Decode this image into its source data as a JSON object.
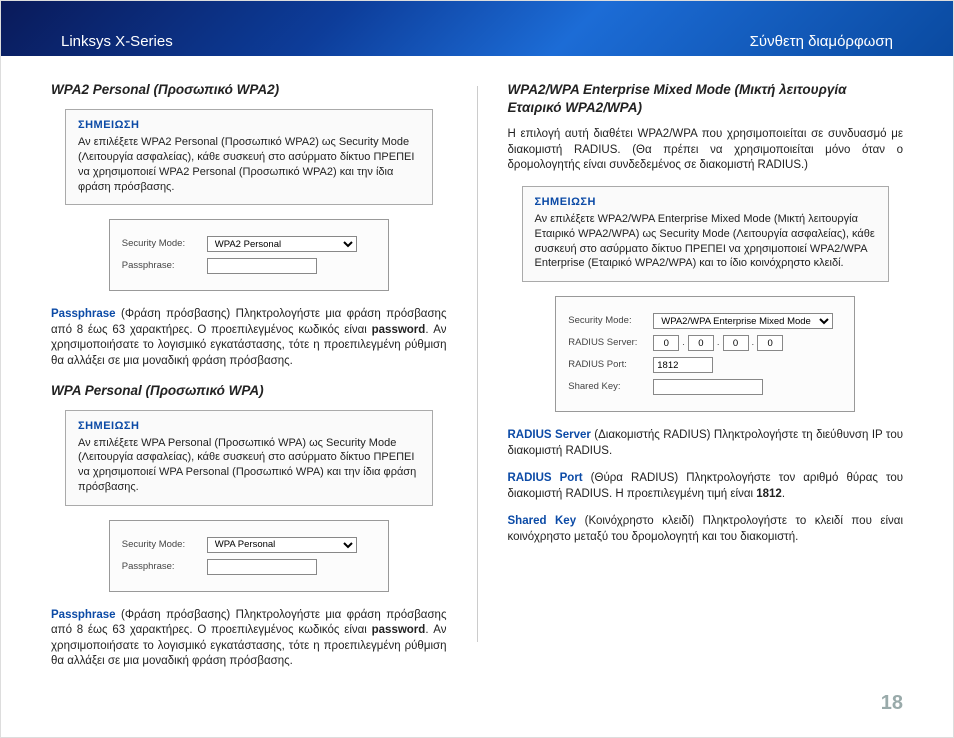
{
  "header": {
    "left": "Linksys X-Series",
    "right": "Σύνθετη διαμόρφωση"
  },
  "pageNumber": "18",
  "left": {
    "s1": {
      "heading": "WPA2 Personal (Προσωπικό WPA2)",
      "noteTitle": "ΣΗΜΕΙΩΣΗ",
      "note": "Αν επιλέξετε WPA2 Personal (Προσωπικό WPA2) ως Security Mode (Λειτουργία ασφαλείας), κάθε συσκευή στο ασύρματο δίκτυο ΠΡΕΠΕΙ να χρησιμοποιεί WPA2 Personal (Προσωπικό WPA2) και την ίδια φράση πρόσβασης.",
      "panel": {
        "secModeLabel": "Security Mode:",
        "secModeValue": "WPA2 Personal",
        "passLabel": "Passphrase:",
        "passValue": ""
      },
      "term": "Passphrase",
      "text1": " (Φράση πρόσβασης) Πληκτρολογήστε μια φράση πρόσβασης από 8 έως 63 χαρακτήρες. Ο προεπιλεγμένος κωδικός είναι ",
      "bold": "password",
      "text2": ". Αν χρησιμοποιήσατε το λογισμικό εγκατάστασης, τότε η προεπιλεγμένη ρύθμιση θα αλλάξει σε μια μοναδική φράση πρόσβασης."
    },
    "s2": {
      "heading": "WPA Personal (Προσωπικό WPA)",
      "noteTitle": "ΣΗΜΕΙΩΣΗ",
      "note": "Αν επιλέξετε WPA Personal (Προσωπικό WPA) ως Security Mode (Λειτουργία ασφαλείας), κάθε συσκευή στο ασύρματο δίκτυο ΠΡΕΠΕΙ να χρησιμοποιεί WPA Personal (Προσωπικό WPA) και την ίδια φράση πρόσβασης.",
      "panel": {
        "secModeLabel": "Security Mode:",
        "secModeValue": "WPA Personal",
        "passLabel": "Passphrase:",
        "passValue": ""
      },
      "term": "Passphrase",
      "text1": " (Φράση πρόσβασης) Πληκτρολογήστε μια φράση πρόσβασης από 8 έως 63 χαρακτήρες. Ο προεπιλεγμένος κωδικός είναι ",
      "bold": "password",
      "text2": ". Αν χρησιμοποιήσατε το λογισμικό εγκατάστασης, τότε η προεπιλεγμένη ρύθμιση θα αλλάξει σε μια μοναδική φράση πρόσβασης."
    }
  },
  "right": {
    "heading": "WPA2/WPA Enterprise Mixed Mode (Μικτή λειτουργία Εταιρικό WPA2/WPA)",
    "intro": "Η επιλογή αυτή διαθέτει WPA2/WPA που χρησιμοποιείται σε συνδυασμό με διακομιστή RADIUS. (Θα πρέπει να χρησιμοποιείται μόνο όταν ο δρομολογητής είναι συνδεδεμένος σε διακομιστή RADIUS.)",
    "noteTitle": "ΣΗΜΕΙΩΣΗ",
    "note": "Αν επιλέξετε WPA2/WPA Enterprise Mixed Mode (Μικτή λειτουργία Εταιρικό WPA2/WPA) ως Security Mode (Λειτουργία ασφαλείας), κάθε συσκευή στο ασύρματο δίκτυο ΠΡΕΠΕΙ να χρησιμοποιεί WPA2/WPA Enterprise (Εταιρικό WPA2/WPA) και το ίδιο κοινόχρηστο κλειδί.",
    "panel": {
      "secModeLabel": "Security Mode:",
      "secModeValue": "WPA2/WPA Enterprise Mixed Mode",
      "radiusServerLabel": "RADIUS Server:",
      "ip": [
        "0",
        "0",
        "0",
        "0"
      ],
      "radiusPortLabel": "RADIUS Port:",
      "radiusPortValue": "1812",
      "sharedKeyLabel": "Shared Key:",
      "sharedKeyValue": ""
    },
    "p1": {
      "term": "RADIUS Server",
      "text": " (Διακομιστής RADIUS)  Πληκτρολογήστε τη διεύθυνση IP του διακομιστή RADIUS."
    },
    "p2": {
      "term": "RADIUS Port",
      "text1": " (Θύρα RADIUS) Πληκτρολογήστε τον αριθμό θύρας του διακομιστή RADIUS. Η προεπιλεγμένη τιμή είναι ",
      "bold": "1812",
      "text2": "."
    },
    "p3": {
      "term": "Shared Key",
      "text": " (Κοινόχρηστο κλειδί) Πληκτρολογήστε το κλειδί που είναι κοινόχρηστο μεταξύ του δρομολογητή και του διακομιστή."
    }
  }
}
